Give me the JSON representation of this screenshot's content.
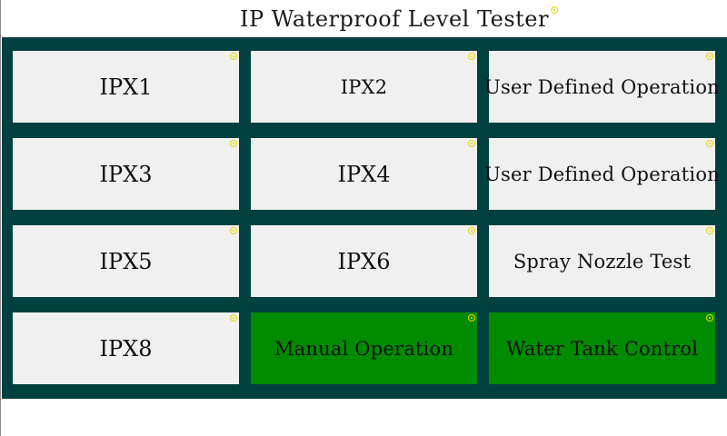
{
  "title": "IP Waterproof Level Tester",
  "buttons": [
    {
      "label": "IPX1"
    },
    {
      "label": "IPX2"
    },
    {
      "label": "User Defined Operation"
    },
    {
      "label": "IPX3"
    },
    {
      "label": "IPX4"
    },
    {
      "label": "User Defined Operation"
    },
    {
      "label": "IPX5"
    },
    {
      "label": "IPX6"
    },
    {
      "label": "Spray Nozzle Test"
    },
    {
      "label": "IPX8"
    },
    {
      "label": "Manual Operation"
    },
    {
      "label": "Water Tank Control"
    }
  ],
  "colors": {
    "panel": "#00403f",
    "button": "#f0f0f0",
    "active_button": "#008b00",
    "marker": "#e6d800"
  }
}
